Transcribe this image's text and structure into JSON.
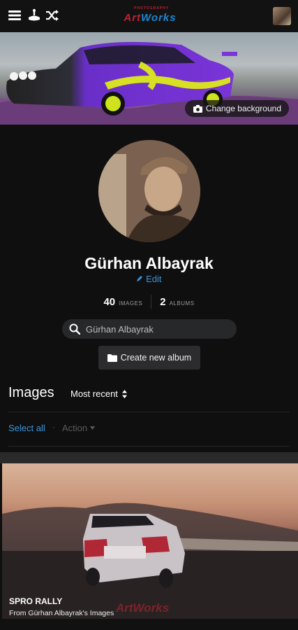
{
  "header": {
    "logo_top": "PHOTOGRAPHY",
    "logo_a": "Art",
    "logo_b": "Works",
    "icons": [
      "menu-icon",
      "game-icon",
      "shuffle-icon"
    ]
  },
  "cover": {
    "change_background_label": "Change background"
  },
  "profile": {
    "name": "Gürhan Albayrak",
    "edit_label": "Edit",
    "stats": [
      {
        "value": "40",
        "label": "IMAGES"
      },
      {
        "value": "2",
        "label": "ALBUMS"
      }
    ]
  },
  "search": {
    "value": "Gürhan Albayrak"
  },
  "create_album_label": "Create new album",
  "images": {
    "heading": "Images",
    "sort_label": "Most recent",
    "select_all_label": "Select all",
    "separator": "·",
    "action_label": "Action"
  },
  "card": {
    "title": "SPRO RALLY",
    "subtitle": "From Gürhan Albayrak's Images",
    "watermark": "ArtWorks"
  },
  "colors": {
    "accent": "#3b95d8",
    "brand_red": "#c02235",
    "background": "#0f0f10"
  }
}
